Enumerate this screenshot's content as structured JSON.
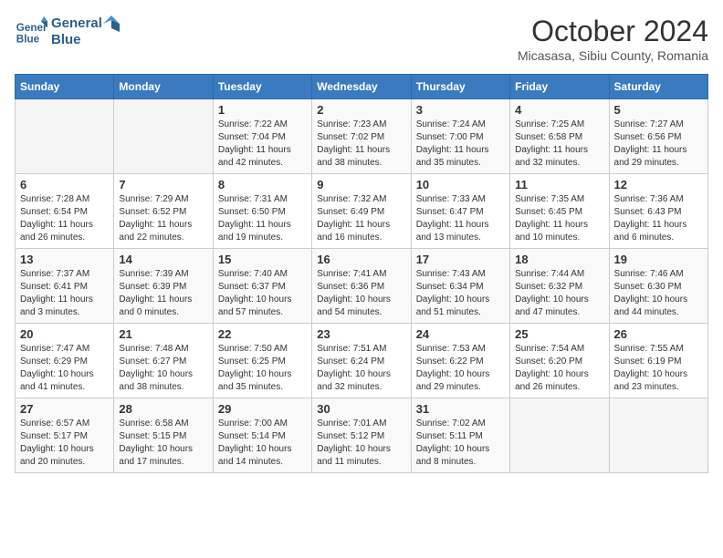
{
  "header": {
    "logo_line1": "General",
    "logo_line2": "Blue",
    "month": "October 2024",
    "location": "Micasasa, Sibiu County, Romania"
  },
  "weekdays": [
    "Sunday",
    "Monday",
    "Tuesday",
    "Wednesday",
    "Thursday",
    "Friday",
    "Saturday"
  ],
  "weeks": [
    [
      {
        "day": "",
        "info": ""
      },
      {
        "day": "",
        "info": ""
      },
      {
        "day": "1",
        "info": "Sunrise: 7:22 AM\nSunset: 7:04 PM\nDaylight: 11 hours and 42 minutes."
      },
      {
        "day": "2",
        "info": "Sunrise: 7:23 AM\nSunset: 7:02 PM\nDaylight: 11 hours and 38 minutes."
      },
      {
        "day": "3",
        "info": "Sunrise: 7:24 AM\nSunset: 7:00 PM\nDaylight: 11 hours and 35 minutes."
      },
      {
        "day": "4",
        "info": "Sunrise: 7:25 AM\nSunset: 6:58 PM\nDaylight: 11 hours and 32 minutes."
      },
      {
        "day": "5",
        "info": "Sunrise: 7:27 AM\nSunset: 6:56 PM\nDaylight: 11 hours and 29 minutes."
      }
    ],
    [
      {
        "day": "6",
        "info": "Sunrise: 7:28 AM\nSunset: 6:54 PM\nDaylight: 11 hours and 26 minutes."
      },
      {
        "day": "7",
        "info": "Sunrise: 7:29 AM\nSunset: 6:52 PM\nDaylight: 11 hours and 22 minutes."
      },
      {
        "day": "8",
        "info": "Sunrise: 7:31 AM\nSunset: 6:50 PM\nDaylight: 11 hours and 19 minutes."
      },
      {
        "day": "9",
        "info": "Sunrise: 7:32 AM\nSunset: 6:49 PM\nDaylight: 11 hours and 16 minutes."
      },
      {
        "day": "10",
        "info": "Sunrise: 7:33 AM\nSunset: 6:47 PM\nDaylight: 11 hours and 13 minutes."
      },
      {
        "day": "11",
        "info": "Sunrise: 7:35 AM\nSunset: 6:45 PM\nDaylight: 11 hours and 10 minutes."
      },
      {
        "day": "12",
        "info": "Sunrise: 7:36 AM\nSunset: 6:43 PM\nDaylight: 11 hours and 6 minutes."
      }
    ],
    [
      {
        "day": "13",
        "info": "Sunrise: 7:37 AM\nSunset: 6:41 PM\nDaylight: 11 hours and 3 minutes."
      },
      {
        "day": "14",
        "info": "Sunrise: 7:39 AM\nSunset: 6:39 PM\nDaylight: 11 hours and 0 minutes."
      },
      {
        "day": "15",
        "info": "Sunrise: 7:40 AM\nSunset: 6:37 PM\nDaylight: 10 hours and 57 minutes."
      },
      {
        "day": "16",
        "info": "Sunrise: 7:41 AM\nSunset: 6:36 PM\nDaylight: 10 hours and 54 minutes."
      },
      {
        "day": "17",
        "info": "Sunrise: 7:43 AM\nSunset: 6:34 PM\nDaylight: 10 hours and 51 minutes."
      },
      {
        "day": "18",
        "info": "Sunrise: 7:44 AM\nSunset: 6:32 PM\nDaylight: 10 hours and 47 minutes."
      },
      {
        "day": "19",
        "info": "Sunrise: 7:46 AM\nSunset: 6:30 PM\nDaylight: 10 hours and 44 minutes."
      }
    ],
    [
      {
        "day": "20",
        "info": "Sunrise: 7:47 AM\nSunset: 6:29 PM\nDaylight: 10 hours and 41 minutes."
      },
      {
        "day": "21",
        "info": "Sunrise: 7:48 AM\nSunset: 6:27 PM\nDaylight: 10 hours and 38 minutes."
      },
      {
        "day": "22",
        "info": "Sunrise: 7:50 AM\nSunset: 6:25 PM\nDaylight: 10 hours and 35 minutes."
      },
      {
        "day": "23",
        "info": "Sunrise: 7:51 AM\nSunset: 6:24 PM\nDaylight: 10 hours and 32 minutes."
      },
      {
        "day": "24",
        "info": "Sunrise: 7:53 AM\nSunset: 6:22 PM\nDaylight: 10 hours and 29 minutes."
      },
      {
        "day": "25",
        "info": "Sunrise: 7:54 AM\nSunset: 6:20 PM\nDaylight: 10 hours and 26 minutes."
      },
      {
        "day": "26",
        "info": "Sunrise: 7:55 AM\nSunset: 6:19 PM\nDaylight: 10 hours and 23 minutes."
      }
    ],
    [
      {
        "day": "27",
        "info": "Sunrise: 6:57 AM\nSunset: 5:17 PM\nDaylight: 10 hours and 20 minutes."
      },
      {
        "day": "28",
        "info": "Sunrise: 6:58 AM\nSunset: 5:15 PM\nDaylight: 10 hours and 17 minutes."
      },
      {
        "day": "29",
        "info": "Sunrise: 7:00 AM\nSunset: 5:14 PM\nDaylight: 10 hours and 14 minutes."
      },
      {
        "day": "30",
        "info": "Sunrise: 7:01 AM\nSunset: 5:12 PM\nDaylight: 10 hours and 11 minutes."
      },
      {
        "day": "31",
        "info": "Sunrise: 7:02 AM\nSunset: 5:11 PM\nDaylight: 10 hours and 8 minutes."
      },
      {
        "day": "",
        "info": ""
      },
      {
        "day": "",
        "info": ""
      }
    ]
  ]
}
